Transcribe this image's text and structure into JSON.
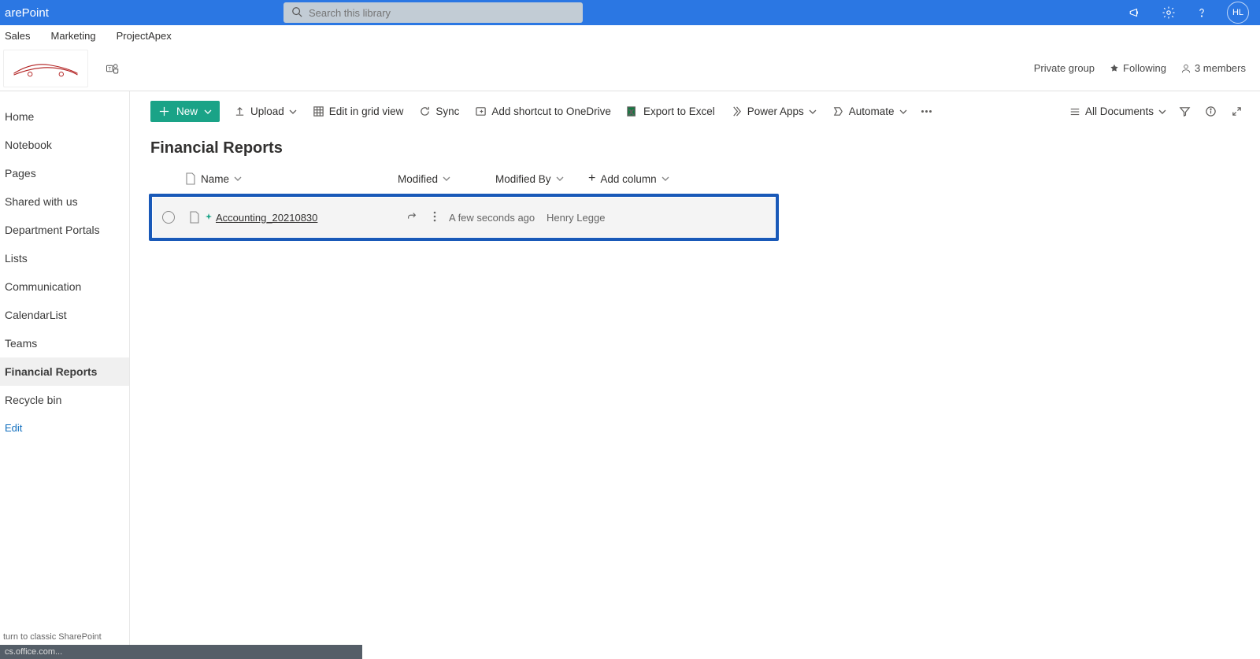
{
  "suite": {
    "app_name": "arePoint",
    "avatar_initials": "HL"
  },
  "search": {
    "placeholder": "Search this library"
  },
  "hub_nav": {
    "items": [
      "Sales",
      "Marketing",
      "ProjectApex"
    ]
  },
  "site_header": {
    "privacy": "Private group",
    "following": "Following",
    "members": "3 members"
  },
  "left_nav": {
    "items": [
      "Home",
      "Notebook",
      "Pages",
      "Shared with us",
      "Department Portals",
      "Lists",
      "Communication",
      "CalendarList",
      "Teams",
      "Financial Reports",
      "Recycle bin"
    ],
    "selected": "Financial Reports",
    "edit": "Edit",
    "return": "turn to classic SharePoint",
    "status": "cs.office.com..."
  },
  "cmdbar": {
    "new": "New",
    "upload": "Upload",
    "edit_grid": "Edit in grid view",
    "sync": "Sync",
    "shortcut": "Add shortcut to OneDrive",
    "excel": "Export to Excel",
    "powerapps": "Power Apps",
    "automate": "Automate",
    "view": "All Documents"
  },
  "page": {
    "title": "Financial Reports"
  },
  "columns": {
    "name": "Name",
    "modified": "Modified",
    "modified_by": "Modified By",
    "add": "Add column"
  },
  "rows": [
    {
      "name": "Accounting_20210830",
      "modified": "A few seconds ago",
      "modified_by": "Henry Legge"
    }
  ]
}
